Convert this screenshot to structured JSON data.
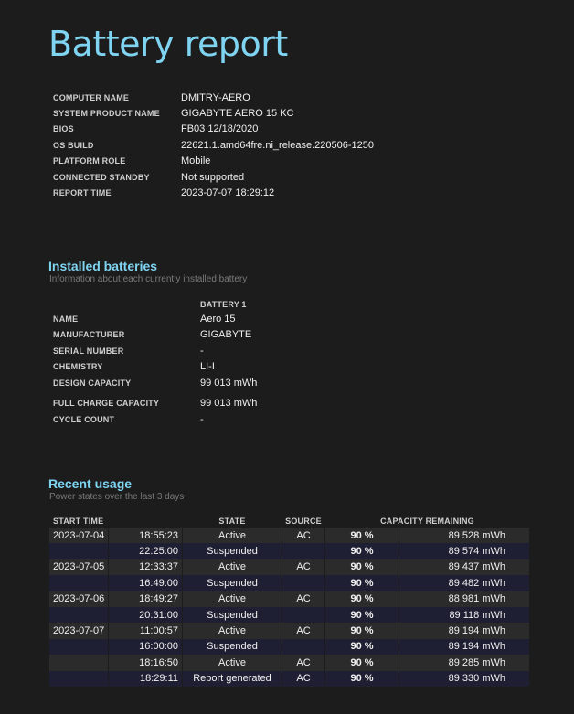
{
  "title": "Battery report",
  "system": [
    {
      "label": "COMPUTER NAME",
      "value": "DMITRY-AERO"
    },
    {
      "label": "SYSTEM PRODUCT NAME",
      "value": "GIGABYTE AERO 15 KC"
    },
    {
      "label": "BIOS",
      "value": "FB03 12/18/2020"
    },
    {
      "label": "OS BUILD",
      "value": "22621.1.amd64fre.ni_release.220506-1250"
    },
    {
      "label": "PLATFORM ROLE",
      "value": "Mobile"
    },
    {
      "label": "CONNECTED STANDBY",
      "value": "Not supported"
    },
    {
      "label": "REPORT TIME",
      "value": "2023-07-07  18:29:12"
    }
  ],
  "installed": {
    "title": "Installed batteries",
    "subtitle": "Information about each currently installed battery",
    "column": "BATTERY 1",
    "rows": [
      {
        "label": "NAME",
        "value": "Aero 15"
      },
      {
        "label": "MANUFACTURER",
        "value": "GIGABYTE"
      },
      {
        "label": "SERIAL NUMBER",
        "value": "-"
      },
      {
        "label": "CHEMISTRY",
        "value": "LI-I"
      },
      {
        "label": "DESIGN CAPACITY",
        "value": "99 013 mWh"
      },
      {
        "label": "FULL CHARGE CAPACITY",
        "value": "99 013 mWh"
      },
      {
        "label": "CYCLE COUNT",
        "value": "-"
      }
    ]
  },
  "usage": {
    "title": "Recent usage",
    "subtitle": "Power states over the last 3 days",
    "headers": {
      "start": "START TIME",
      "state": "STATE",
      "source": "SOURCE",
      "capacity": "CAPACITY REMAINING"
    },
    "rows": [
      {
        "date": "2023-07-04",
        "time": "18:55:23",
        "state": "Active",
        "source": "AC",
        "pct": "90 %",
        "cap": "89 528 mWh"
      },
      {
        "date": "",
        "time": "22:25:00",
        "state": "Suspended",
        "source": "",
        "pct": "90 %",
        "cap": "89 574 mWh"
      },
      {
        "date": "2023-07-05",
        "time": "12:33:37",
        "state": "Active",
        "source": "AC",
        "pct": "90 %",
        "cap": "89 437 mWh"
      },
      {
        "date": "",
        "time": "16:49:00",
        "state": "Suspended",
        "source": "",
        "pct": "90 %",
        "cap": "89 482 mWh"
      },
      {
        "date": "2023-07-06",
        "time": "18:49:27",
        "state": "Active",
        "source": "AC",
        "pct": "90 %",
        "cap": "88 981 mWh"
      },
      {
        "date": "",
        "time": "20:31:00",
        "state": "Suspended",
        "source": "",
        "pct": "90 %",
        "cap": "89 118 mWh"
      },
      {
        "date": "2023-07-07",
        "time": "11:00:57",
        "state": "Active",
        "source": "AC",
        "pct": "90 %",
        "cap": "89 194 mWh"
      },
      {
        "date": "",
        "time": "16:00:00",
        "state": "Suspended",
        "source": "",
        "pct": "90 %",
        "cap": "89 194 mWh"
      },
      {
        "date": "",
        "time": "18:16:50",
        "state": "Active",
        "source": "AC",
        "pct": "90 %",
        "cap": "89 285 mWh"
      },
      {
        "date": "",
        "time": "18:29:11",
        "state": "Report generated",
        "source": "AC",
        "pct": "90 %",
        "cap": "89 330 mWh"
      }
    ]
  }
}
